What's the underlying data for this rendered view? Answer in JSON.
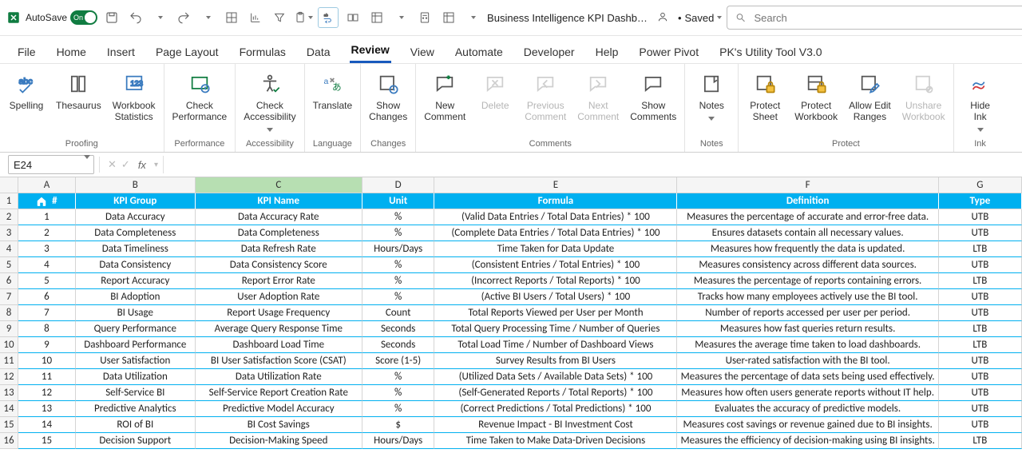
{
  "titlebar": {
    "autosave_label": "AutoSave",
    "autosave_on_label": "On",
    "doc_name": "Business Intelligence KPI Dashb…",
    "saved_label": "Saved",
    "search_placeholder": "Search"
  },
  "tabs": {
    "file": "File",
    "home": "Home",
    "insert": "Insert",
    "page_layout": "Page Layout",
    "formulas": "Formulas",
    "data": "Data",
    "review": "Review",
    "view": "View",
    "automate": "Automate",
    "developer": "Developer",
    "help": "Help",
    "power_pivot": "Power Pivot",
    "pk_tool": "PK's Utility Tool V3.0"
  },
  "ribbon": {
    "proofing": {
      "label": "Proofing",
      "spelling": "Spelling",
      "thesaurus": "Thesaurus",
      "workbook_stats": "Workbook\nStatistics"
    },
    "performance": {
      "label": "Performance",
      "check_performance": "Check\nPerformance"
    },
    "accessibility": {
      "label": "Accessibility",
      "check_accessibility": "Check\nAccessibility"
    },
    "language": {
      "label": "Language",
      "translate": "Translate"
    },
    "changes": {
      "label": "Changes",
      "show_changes": "Show\nChanges"
    },
    "comments": {
      "label": "Comments",
      "new_comment": "New\nComment",
      "delete": "Delete",
      "prev": "Previous\nComment",
      "next": "Next\nComment",
      "show_comments": "Show\nComments"
    },
    "notes": {
      "label": "Notes",
      "notes": "Notes"
    },
    "protect": {
      "label": "Protect",
      "protect_sheet": "Protect\nSheet",
      "protect_workbook": "Protect\nWorkbook",
      "allow_edit_ranges": "Allow Edit\nRanges",
      "unshare_workbook": "Unshare\nWorkbook"
    },
    "ink": {
      "label": "Ink",
      "hide_ink": "Hide\nInk"
    }
  },
  "namebox": {
    "ref": "E24"
  },
  "column_headers": [
    "A",
    "B",
    "C",
    "D",
    "E",
    "F",
    "G"
  ],
  "header_row": {
    "a": "#",
    "b": "KPI  Group",
    "c": "KPI Name",
    "d": "Unit",
    "e": "Formula",
    "f": "Definition",
    "g": "Type"
  },
  "chart_data": {
    "type": "table",
    "columns": [
      "#",
      "KPI Group",
      "KPI Name",
      "Unit",
      "Formula",
      "Definition",
      "Type"
    ],
    "rows": [
      {
        "n": "1",
        "group": "Data Accuracy",
        "name": "Data Accuracy Rate",
        "unit": "%",
        "formula": "(Valid Data Entries / Total Data Entries) * 100",
        "definition": "Measures the percentage of accurate and error-free data.",
        "type": "UTB"
      },
      {
        "n": "2",
        "group": "Data Completeness",
        "name": "Data Completeness",
        "unit": "%",
        "formula": "(Complete Data Entries / Total Data Entries) * 100",
        "definition": "Ensures datasets contain all necessary values.",
        "type": "UTB"
      },
      {
        "n": "3",
        "group": "Data Timeliness",
        "name": "Data Refresh Rate",
        "unit": "Hours/Days",
        "formula": "Time Taken for Data Update",
        "definition": "Measures how frequently the data is updated.",
        "type": "LTB"
      },
      {
        "n": "4",
        "group": "Data Consistency",
        "name": "Data Consistency Score",
        "unit": "%",
        "formula": "(Consistent Entries / Total Entries) * 100",
        "definition": "Measures consistency across different data sources.",
        "type": "UTB"
      },
      {
        "n": "5",
        "group": "Report Accuracy",
        "name": "Report Error Rate",
        "unit": "%",
        "formula": "(Incorrect Reports / Total Reports) * 100",
        "definition": "Measures the percentage of reports containing errors.",
        "type": "LTB"
      },
      {
        "n": "6",
        "group": "BI Adoption",
        "name": "User Adoption Rate",
        "unit": "%",
        "formula": "(Active BI Users / Total Users) * 100",
        "definition": "Tracks how many employees actively use the BI tool.",
        "type": "UTB"
      },
      {
        "n": "7",
        "group": "BI Usage",
        "name": "Report Usage Frequency",
        "unit": "Count",
        "formula": "Total Reports Viewed per User per Month",
        "definition": "Number of reports accessed per user per period.",
        "type": "UTB"
      },
      {
        "n": "8",
        "group": "Query Performance",
        "name": "Average Query Response Time",
        "unit": "Seconds",
        "formula": "Total Query Processing Time / Number of Queries",
        "definition": "Measures how fast queries return results.",
        "type": "LTB"
      },
      {
        "n": "9",
        "group": "Dashboard Performance",
        "name": "Dashboard Load Time",
        "unit": "Seconds",
        "formula": "Total Load Time / Number of Dashboard Views",
        "definition": "Measures the average time taken to load dashboards.",
        "type": "LTB"
      },
      {
        "n": "10",
        "group": "User Satisfaction",
        "name": "BI User Satisfaction Score (CSAT)",
        "unit": "Score (1-5)",
        "formula": "Survey Results from BI Users",
        "definition": "User-rated satisfaction with the BI tool.",
        "type": "UTB"
      },
      {
        "n": "11",
        "group": "Data Utilization",
        "name": "Data Utilization Rate",
        "unit": "%",
        "formula": "(Utilized Data Sets / Available Data Sets) * 100",
        "definition": "Measures the percentage of data sets being used effectively.",
        "type": "UTB"
      },
      {
        "n": "12",
        "group": "Self-Service BI",
        "name": "Self-Service Report Creation Rate",
        "unit": "%",
        "formula": "(Self-Generated Reports / Total Reports) * 100",
        "definition": "Measures how often users generate reports without IT help.",
        "type": "UTB"
      },
      {
        "n": "13",
        "group": "Predictive Analytics",
        "name": "Predictive Model Accuracy",
        "unit": "%",
        "formula": "(Correct Predictions / Total Predictions) * 100",
        "definition": "Evaluates the accuracy of predictive models.",
        "type": "UTB"
      },
      {
        "n": "14",
        "group": "ROI of BI",
        "name": "BI Cost Savings",
        "unit": "$",
        "formula": "Revenue Impact - BI Investment Cost",
        "definition": "Measures cost savings or revenue gained due to BI insights.",
        "type": "UTB"
      },
      {
        "n": "15",
        "group": "Decision Support",
        "name": "Decision-Making Speed",
        "unit": "Hours/Days",
        "formula": "Time Taken to Make Data-Driven Decisions",
        "definition": "Measures the efficiency of decision-making using BI insights.",
        "type": "LTB"
      }
    ]
  }
}
